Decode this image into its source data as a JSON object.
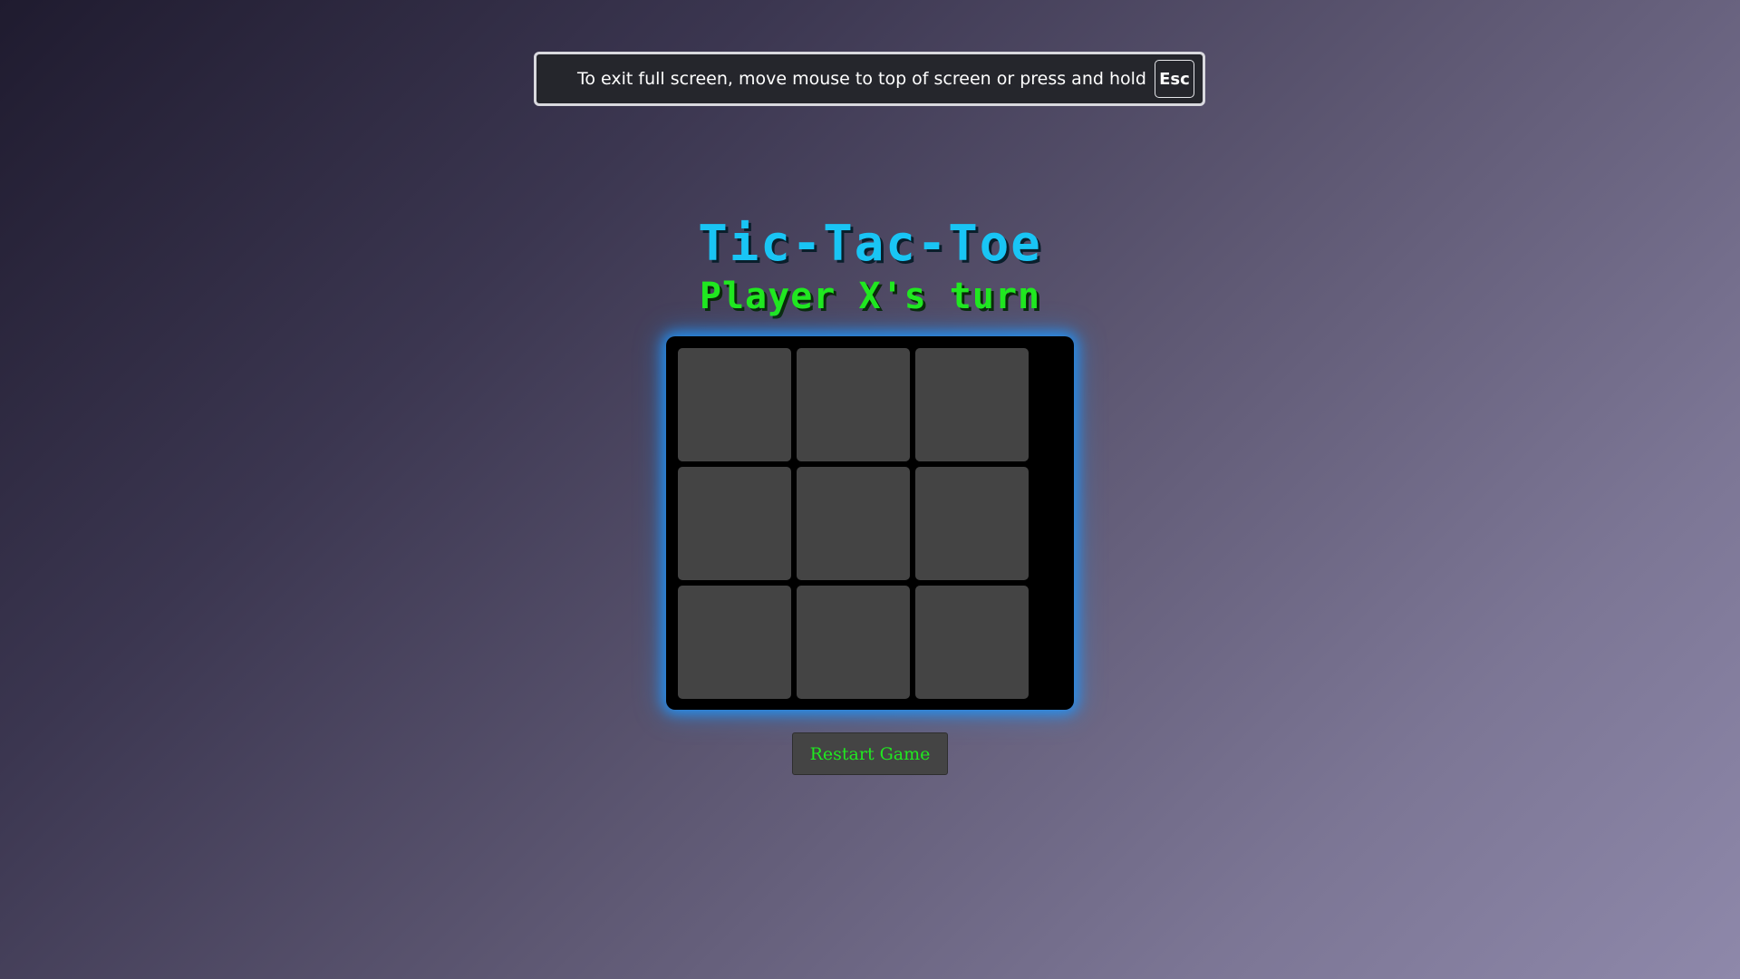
{
  "fullscreen_notice": {
    "message": "To exit full screen, move mouse to top of screen or press and hold",
    "key": "Esc"
  },
  "game": {
    "title": "Tic-Tac-Toe",
    "status": "Player X's turn",
    "board": [
      "",
      "",
      "",
      "",
      "",
      "",
      "",
      "",
      ""
    ],
    "restart_label": "Restart Game"
  },
  "colors": {
    "title": "#19c5f5",
    "status": "#20e820",
    "board_bg": "#000000",
    "cell_bg": "#444444",
    "board_glow": "#1e96ff",
    "notice_bg": "#25262c"
  }
}
